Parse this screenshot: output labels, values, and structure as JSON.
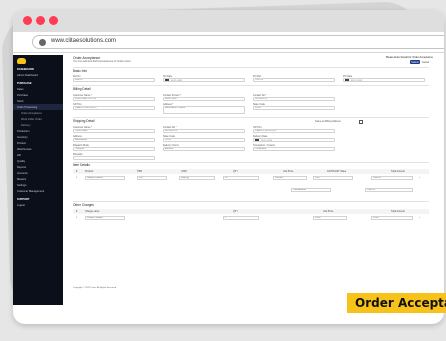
{
  "browser": {
    "url": "www.clitaesolutions.com"
  },
  "sidebar": {
    "sections": [
      {
        "label": "DASHBOARD",
        "items": [
          "Admin Dashboard"
        ]
      },
      {
        "label": "PURCHASE",
        "items": [
          "Sales",
          "Purchase",
          "Stock"
        ]
      },
      {
        "label": "",
        "items": [
          "Order Processing"
        ]
      }
    ],
    "active_children": [
      "Order Acceptance",
      "Work Order Order",
      "Delivery"
    ],
    "more_items": [
      "Production",
      "Inventory",
      "Product",
      "Warehouses",
      "HR",
      "Quality",
      "Reports",
      "Accounts",
      "Masters",
      "Settings",
      "Customer Management"
    ],
    "bottom_section": "SUPPORT",
    "bottom_item": "Logout"
  },
  "page": {
    "title": "Order Acceptance",
    "subtitle": "You can add and Edit Acceptances of Orders Here",
    "notify_label": "Please Enter Email for Order Acceptance",
    "submit_label": "Submit",
    "cancel_label": "Cancel"
  },
  "basic_info": {
    "title": "Basic Info",
    "fields": [
      {
        "label": "Ref No",
        "value": "000020"
      },
      {
        "label": "SO Date",
        "value": "09-11-2023"
      },
      {
        "label": "PO Ref.",
        "value": "ODP/2S"
      },
      {
        "label": "PO Date",
        "value": "09-11-2023"
      }
    ]
  },
  "billing": {
    "title": "Billing Detail",
    "customer_label": "Customer Name *",
    "customer_value": "Cohre Impex Pvt. Ltd.",
    "contact_label": "Contact Person *",
    "contact_value": "Harsh Shah",
    "phone_label": "Contact No *",
    "phone_value": "9874563210",
    "gst_label": "GST No",
    "gst_value": "24ABXCPK8974Q1ZC",
    "address_label": "Address *",
    "address_value": "Ahmedabad, Gujarat",
    "state_label": "State Code",
    "state_value": "24-GJ"
  },
  "shipping": {
    "title": "Shipping Detail",
    "same_as_billing": "Same as Billing Address",
    "customer_label": "Customer Name *",
    "customer_value": "Cohre Impex",
    "contact_label": "Contact No *",
    "contact_value": "9874563210",
    "gst_label": "GST No",
    "gst_value": "24ABXCPK8974Q1ZC",
    "address_label": "Address",
    "address_value": "Ahmedabad",
    "state_label": "State Code",
    "state_value": "24-GJ",
    "delivery_label": "Delivery Date",
    "delivery_value": "30-11-2023",
    "dispatch_label": "Dispatch Mode",
    "dispatch_value": "Transport",
    "delivery_terms_label": "Delivery Terms",
    "delivery_terms_value": "Advance",
    "transporter_label": "Transporter / Courier",
    "transporter_value": "Transporter",
    "remarks_label": "Remarks",
    "remarks_value": "-"
  },
  "items": {
    "title": "Item Details",
    "headers": [
      "#",
      "Product",
      "HSN",
      "UOM",
      "QTY",
      "Unit Price",
      "GST%/GST Value",
      "Total Amount"
    ],
    "rows": [
      {
        "no": "1",
        "product": "Sample Product",
        "hsn": "555",
        "uom": "Kilo(Kg)",
        "qty": "10",
        "price": "200.000",
        "gst": "18%",
        "amount": "2000.00"
      }
    ],
    "subtotal_label": "Total Amount",
    "subtotal_value": "2000.00"
  },
  "other": {
    "title": "Other Charges",
    "headers": [
      "#",
      "Charge name",
      "QTY",
      "Unit Price",
      "Total Amount"
    ],
    "rows": [
      {
        "no": "1",
        "name": "Freight Charges",
        "qty": "1",
        "price": "10.00",
        "amount": "10.00"
      }
    ]
  },
  "footer": {
    "copyright": "Copyright © 2023 Cima. All Rights Reserved."
  },
  "tag": {
    "label": "Order Acceptance"
  }
}
